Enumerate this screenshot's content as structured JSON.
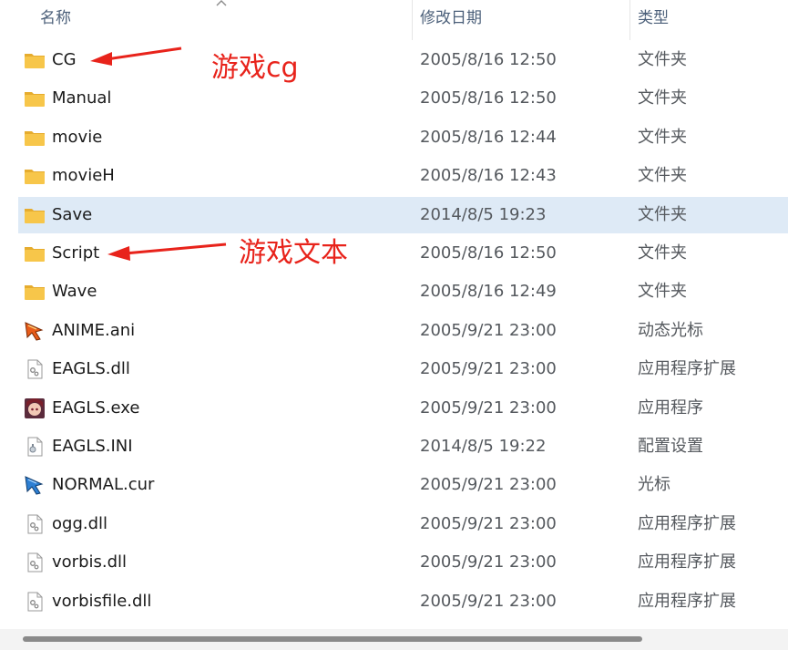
{
  "columns": {
    "name": "名称",
    "date": "修改日期",
    "type": "类型"
  },
  "files": [
    {
      "name": "CG",
      "date": "2005/8/16 12:50",
      "type": "文件夹",
      "icon": "folder-icon"
    },
    {
      "name": "Manual",
      "date": "2005/8/16 12:50",
      "type": "文件夹",
      "icon": "folder-icon"
    },
    {
      "name": "movie",
      "date": "2005/8/16 12:44",
      "type": "文件夹",
      "icon": "folder-icon"
    },
    {
      "name": "movieH",
      "date": "2005/8/16 12:43",
      "type": "文件夹",
      "icon": "folder-icon"
    },
    {
      "name": "Save",
      "date": "2014/8/5 19:23",
      "type": "文件夹",
      "icon": "folder-icon",
      "selected": true
    },
    {
      "name": "Script",
      "date": "2005/8/16 12:50",
      "type": "文件夹",
      "icon": "folder-icon"
    },
    {
      "name": "Wave",
      "date": "2005/8/16 12:49",
      "type": "文件夹",
      "icon": "folder-icon"
    },
    {
      "name": "ANIME.ani",
      "date": "2005/9/21 23:00",
      "type": "动态光标",
      "icon": "animated-cursor-icon"
    },
    {
      "name": "EAGLS.dll",
      "date": "2005/9/21 23:00",
      "type": "应用程序扩展",
      "icon": "dll-file-icon"
    },
    {
      "name": "EAGLS.exe",
      "date": "2005/9/21 23:00",
      "type": "应用程序",
      "icon": "app-exe-icon"
    },
    {
      "name": "EAGLS.INI",
      "date": "2014/8/5 19:22",
      "type": "配置设置",
      "icon": "ini-file-icon"
    },
    {
      "name": "NORMAL.cur",
      "date": "2005/9/21 23:00",
      "type": "光标",
      "icon": "cursor-icon"
    },
    {
      "name": "ogg.dll",
      "date": "2005/9/21 23:00",
      "type": "应用程序扩展",
      "icon": "dll-file-icon"
    },
    {
      "name": "vorbis.dll",
      "date": "2005/9/21 23:00",
      "type": "应用程序扩展",
      "icon": "dll-file-icon"
    },
    {
      "name": "vorbisfile.dll",
      "date": "2005/9/21 23:00",
      "type": "应用程序扩展",
      "icon": "dll-file-icon"
    }
  ],
  "annotations": {
    "cg": "游戏cg",
    "script": "游戏文本"
  },
  "colors": {
    "annotation": "#e8231b",
    "selected_row": "#deeaf6",
    "folder": "#f7c64a"
  }
}
